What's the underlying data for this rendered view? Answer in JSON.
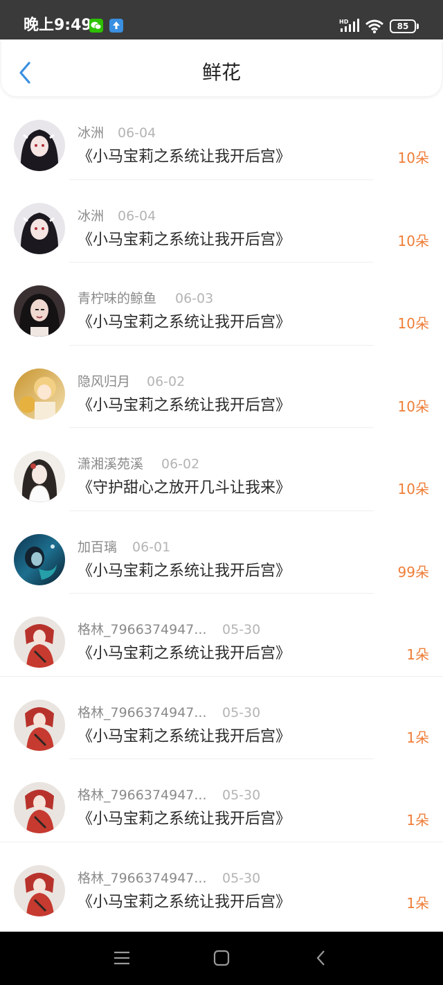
{
  "status_bar": {
    "time": "晚上9:49",
    "network": "HD",
    "battery": "85",
    "icons": [
      "wechat-icon",
      "upload-icon",
      "signal-icon",
      "wifi-icon",
      "battery-icon"
    ]
  },
  "header": {
    "title": "鲜花",
    "back_icon": "chevron-left-icon"
  },
  "colors": {
    "accent": "#3a8fe0",
    "count": "#ef7d37",
    "status_bar_bg": "#3a3a3a"
  },
  "rows": [
    {
      "user": "冰洲",
      "date": "06-04",
      "book": "《小马宝莉之系统让我开后宫》",
      "count": "10朵",
      "avatar": "avatar-girl-dark-hair"
    },
    {
      "user": "冰洲",
      "date": "06-04",
      "book": "《小马宝莉之系统让我开后宫》",
      "count": "10朵",
      "avatar": "avatar-girl-dark-hair"
    },
    {
      "user": "青柠味的鲸鱼",
      "date": "06-03",
      "book": "《小马宝莉之系统让我开后宫》",
      "count": "10朵",
      "avatar": "avatar-woman-dark"
    },
    {
      "user": "隐风归月",
      "date": "06-02",
      "book": "《小马宝莉之系统让我开后宫》",
      "count": "10朵",
      "avatar": "avatar-blonde-child"
    },
    {
      "user": "潇湘溪苑溪",
      "date": "06-02",
      "book": "《守护甜心之放开几斗让我来》",
      "count": "10朵",
      "avatar": "avatar-girl-white-dress"
    },
    {
      "user": "加百璃",
      "date": "06-01",
      "book": "《小马宝莉之系统让我开后宫》",
      "count": "99朵",
      "avatar": "avatar-mermaid-blue"
    },
    {
      "user": "格林_7966374947...",
      "date": "05-30",
      "book": "《小马宝莉之系统让我开后宫》",
      "count": "1朵",
      "avatar": "avatar-girl-red-robe"
    },
    {
      "user": "格林_7966374947...",
      "date": "05-30",
      "book": "《小马宝莉之系统让我开后宫》",
      "count": "1朵",
      "avatar": "avatar-girl-red-robe"
    },
    {
      "user": "格林_7966374947...",
      "date": "05-30",
      "book": "《小马宝莉之系统让我开后宫》",
      "count": "1朵",
      "avatar": "avatar-girl-red-robe"
    },
    {
      "user": "格林_7966374947...",
      "date": "05-30",
      "book": "《小马宝莉之系统让我开后宫》",
      "count": "1朵",
      "avatar": "avatar-girl-red-robe"
    }
  ],
  "nav_bar": {
    "icons": [
      "menu-icon",
      "home-icon",
      "back-icon"
    ]
  }
}
